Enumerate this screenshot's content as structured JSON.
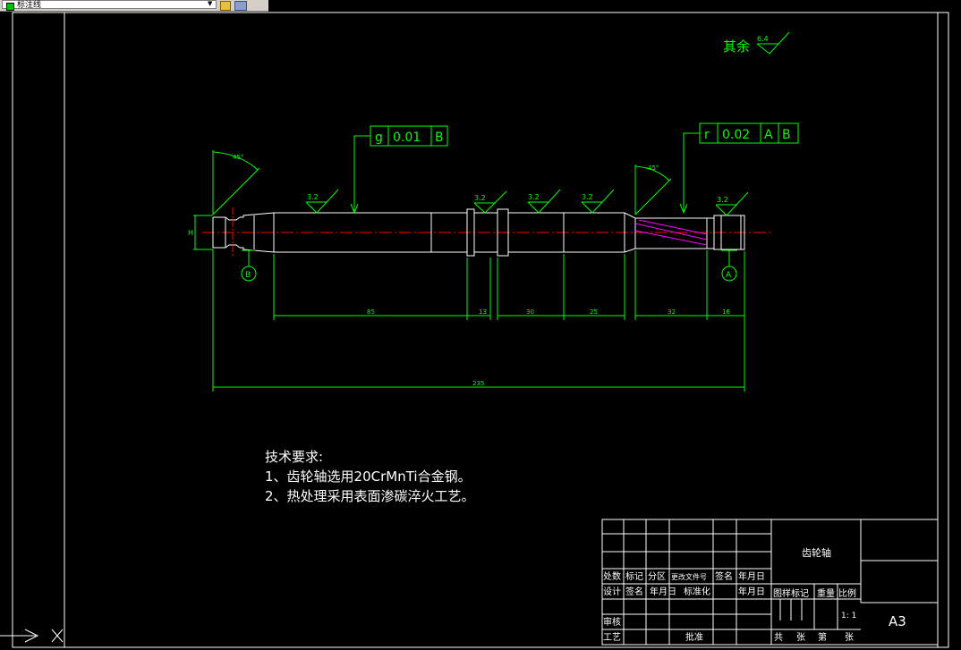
{
  "toolbar": {
    "layer_label": "标注线",
    "layer_color": "#00c000"
  },
  "roughness_other": {
    "label": "其余",
    "value": "6.4"
  },
  "tolerance_left": {
    "symbol": "g",
    "value": "0.01",
    "datum": "B"
  },
  "tolerance_right": {
    "symbol": "r",
    "value": "0.02",
    "datums": [
      "A",
      "B"
    ]
  },
  "roughness_marks": [
    "3.2",
    "3.2",
    "3.2",
    "3.2",
    "3.2"
  ],
  "chamfer_left": "45°",
  "chamfer_right": "45°",
  "height_label": "H",
  "datum_b": "B",
  "datum_a": "A",
  "dimensions": [
    "85",
    "13",
    "30",
    "25",
    "32",
    "16",
    "235"
  ],
  "notes": {
    "title": "技术要求:",
    "line1": "1、齿轮轴选用20CrMnTi合金钢。",
    "line2": "2、热处理采用表面渗碳淬火工艺。"
  },
  "title_block": {
    "part_name": "齿轮轴",
    "sheet_size": "A3",
    "scale": "1: 1",
    "row_labels_1": [
      "处数",
      "标记",
      "分区",
      "更改文件号",
      "签名",
      "年月日"
    ],
    "row_labels_2": [
      "设计",
      "签名",
      "年月日",
      "标准化",
      "",
      "年月日"
    ],
    "right_labels": [
      "图样标记",
      "重量",
      "比例"
    ],
    "audit": "审核",
    "process": "工艺",
    "standard": "标准",
    "approve": "批准",
    "sheet_info": [
      "共",
      "张",
      "第",
      "张"
    ]
  },
  "colors": {
    "green": "#00ff00",
    "white": "#ffffff",
    "red": "#ff0000",
    "magenta": "#ff00ff"
  }
}
